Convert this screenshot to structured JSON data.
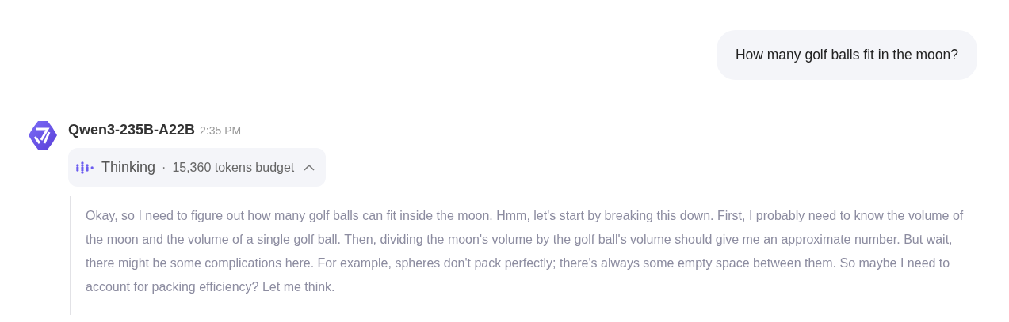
{
  "user_message": {
    "text": "How many golf balls fit in the moon?"
  },
  "assistant": {
    "name": "Qwen3-235B-A22B",
    "time": "2:35 PM",
    "thinking": {
      "label": "Thinking",
      "separator": "·",
      "budget": "15,360 tokens budget",
      "expanded": true,
      "text": "Okay, so I need to figure out how many golf balls can fit inside the moon. Hmm, let's start by breaking this down. First, I probably need to know the volume of the moon and the volume of a single golf ball. Then, dividing the moon's volume by the golf ball's volume should give me an approximate number. But wait, there might be some complications here. For example, spheres don't pack perfectly; there's always some empty space between them. So maybe I need to account for packing efficiency? Let me think."
    }
  }
}
